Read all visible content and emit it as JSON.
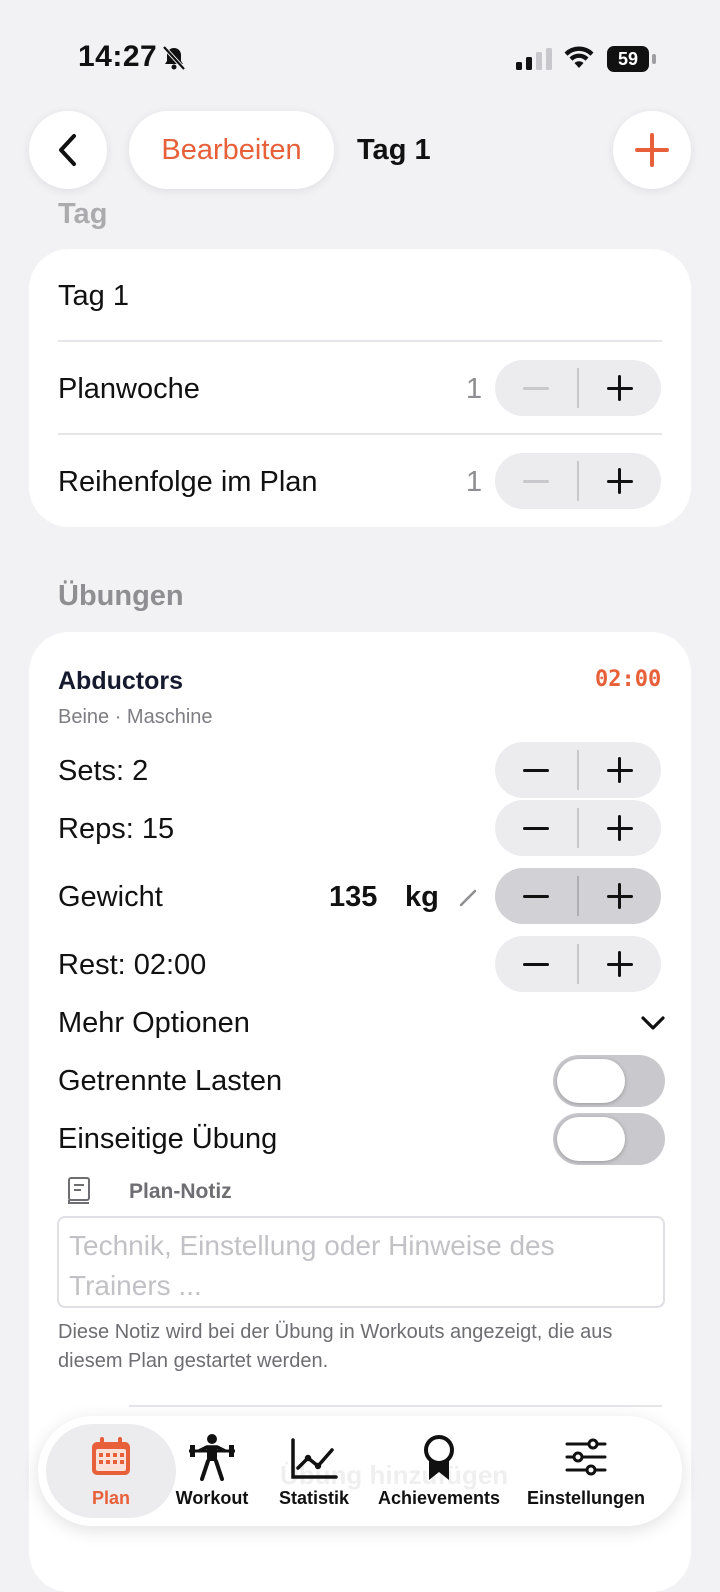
{
  "status_bar": {
    "time": "14:27",
    "battery": "59"
  },
  "nav": {
    "edit_label": "Bearbeiten",
    "title": "Tag 1"
  },
  "day_section": {
    "label": "Tag",
    "name": "Tag 1",
    "week_label": "Planwoche",
    "week_value": "1",
    "order_label": "Reihenfolge im Plan",
    "order_value": "1"
  },
  "exercises_section": {
    "label": "Übungen",
    "exercise": {
      "name": "Abductors",
      "meta": "Beine · Maschine",
      "timer": "02:00",
      "sets_label": "Sets: 2",
      "reps_label": "Reps: 15",
      "weight_label": "Gewicht",
      "weight_value": "135",
      "weight_unit": "kg",
      "rest_label": "Rest: 02:00",
      "more_options_label": "Mehr Optionen",
      "split_loads_label": "Getrennte Lasten",
      "split_loads_on": false,
      "unilateral_label": "Einseitige Übung",
      "unilateral_on": false,
      "note_label": "Plan-Notiz",
      "note_placeholder": "Technik, Einstellung oder Hinweise des Trainers ...",
      "note_hint": "Diese Notiz wird bei der Übung in Workouts angezeigt, die aus diesem Plan gestartet werden."
    },
    "add_exercise_label": "Übung hinzufügen"
  },
  "tabbar": {
    "tabs": [
      {
        "label": "Plan",
        "icon": "calendar-icon",
        "active": true
      },
      {
        "label": "Workout",
        "icon": "weightlifter-icon",
        "active": false
      },
      {
        "label": "Statistik",
        "icon": "line-chart-icon",
        "active": false
      },
      {
        "label": "Achievements",
        "icon": "award-ribbon-icon",
        "active": false
      },
      {
        "label": "Einstellungen",
        "icon": "sliders-icon",
        "active": false
      }
    ]
  },
  "colors": {
    "accent": "#e8603a",
    "background": "#f2f2f4",
    "card": "#ffffff"
  }
}
